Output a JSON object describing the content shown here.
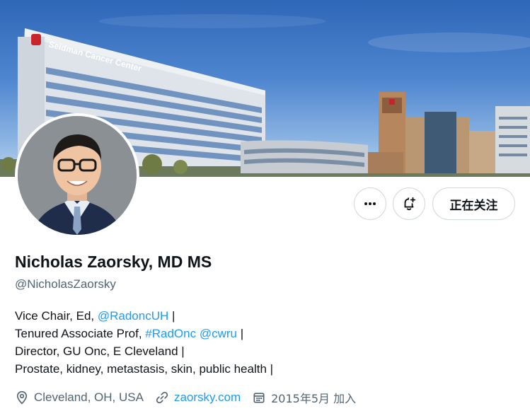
{
  "banner": {
    "building_sign": "Seidman Cancer Center",
    "building_alt": "Hospital campus buildings"
  },
  "profile": {
    "name": "Nicholas Zaorsky, MD MS",
    "handle": "@NicholasZaorsky",
    "follow_label": "正在关注"
  },
  "bio": {
    "line1": {
      "prefix": "Vice Chair, Ed, ",
      "mention": "@RadoncUH",
      "suffix": " |"
    },
    "line2": {
      "prefix": "Tenured Associate Prof, ",
      "hashtag": "#RadOnc",
      "space": " ",
      "mention": "@cwru",
      "suffix": " |"
    },
    "line3": "Director, GU Onc, E Cleveland |",
    "line4": "Prostate, kidney, metastasis, skin, public health |"
  },
  "meta": {
    "location": "Cleveland, OH, USA",
    "website": "zaorsky.com",
    "joined": "2015年5月 加入",
    "location_icon": "location-pin-icon",
    "website_icon": "link-icon",
    "joined_icon": "calendar-icon"
  },
  "colors": {
    "link": "#1d9bf0",
    "secondary_text": "#536471",
    "primary_text": "#0f1419",
    "border": "#cfd9de"
  }
}
